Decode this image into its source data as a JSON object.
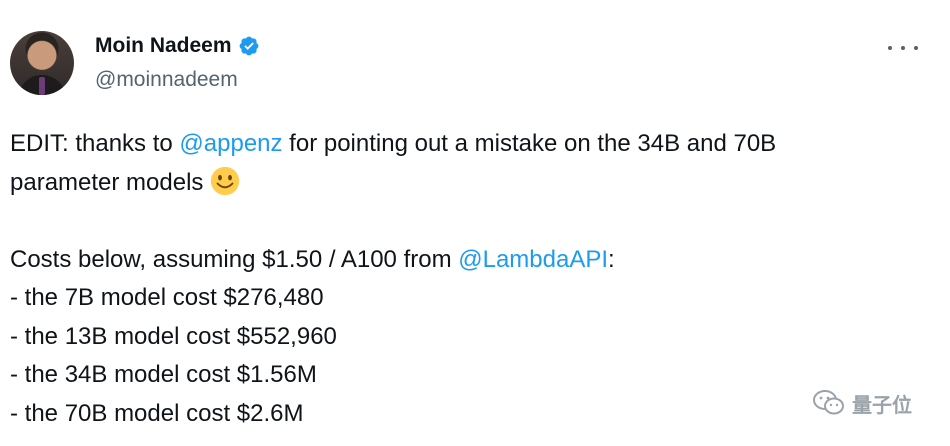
{
  "author": {
    "display_name": "Moin Nadeem",
    "handle": "@moinnadeem"
  },
  "tweet": {
    "line1": {
      "prefix": "EDIT: thanks to ",
      "mention": "@appenz",
      "suffix": " for pointing out a mistake on the 34B and 70B"
    },
    "line2": "parameter models",
    "line3": {
      "prefix": "Costs below, assuming $1.50 / A100 from ",
      "mention": "@LambdaAPI",
      "suffix": ":"
    },
    "bullets": [
      "- the 7B model cost $276,480",
      "- the 13B model cost $552,960",
      "- the 34B model cost $1.56M",
      "- the 70B model cost $2.6M"
    ]
  },
  "watermark": {
    "text": "量子位"
  },
  "icons": {
    "verified": "verified-badge-icon",
    "more": "more-options-icon",
    "emoji": "slightly-smiling-face-emoji",
    "watermark_logo": "wechat-logo-icon"
  },
  "colors": {
    "mention": "#1d9bf0",
    "handle": "#536471",
    "text": "#0f1419",
    "verified": "#1d9bf0"
  }
}
